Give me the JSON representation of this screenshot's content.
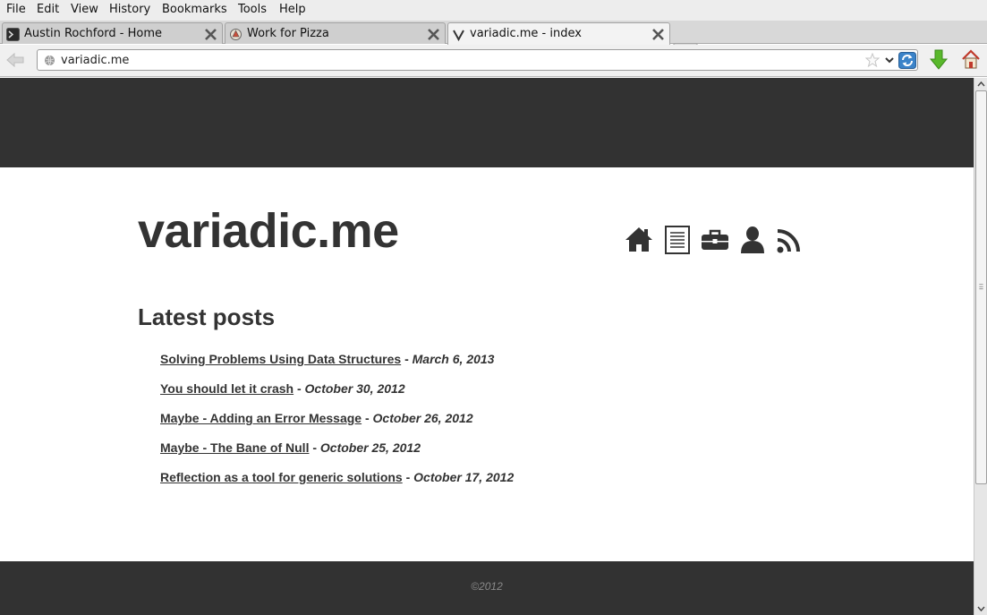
{
  "menubar": {
    "items": [
      "File",
      "Edit",
      "View",
      "History",
      "Bookmarks",
      "Tools",
      "Help"
    ]
  },
  "tabs": [
    {
      "title": "Austin Rochford - Home",
      "active": false
    },
    {
      "title": "Work for Pizza",
      "active": false
    },
    {
      "title": "variadic.me - index",
      "active": true
    }
  ],
  "navbar": {
    "url": "variadic.me"
  },
  "page": {
    "site_title": "variadic.me",
    "nav_icons": [
      "home-icon",
      "document-icon",
      "briefcase-icon",
      "person-icon",
      "rss-icon"
    ],
    "latest_heading": "Latest posts",
    "posts": [
      {
        "title": "Solving Problems Using Data Structures",
        "date": "March 6, 2013"
      },
      {
        "title": "You should let it crash",
        "date": "October 30, 2012"
      },
      {
        "title": "Maybe - Adding an Error Message",
        "date": "October 26, 2012"
      },
      {
        "title": "Maybe - The Bane of Null",
        "date": "October 25, 2012"
      },
      {
        "title": "Reflection as a tool for generic solutions",
        "date": "October 17, 2012"
      }
    ],
    "separator": "-",
    "copyright": "©2012"
  },
  "colors": {
    "band": "#323232",
    "text": "#333333",
    "footer_text": "#8a8a8a"
  }
}
